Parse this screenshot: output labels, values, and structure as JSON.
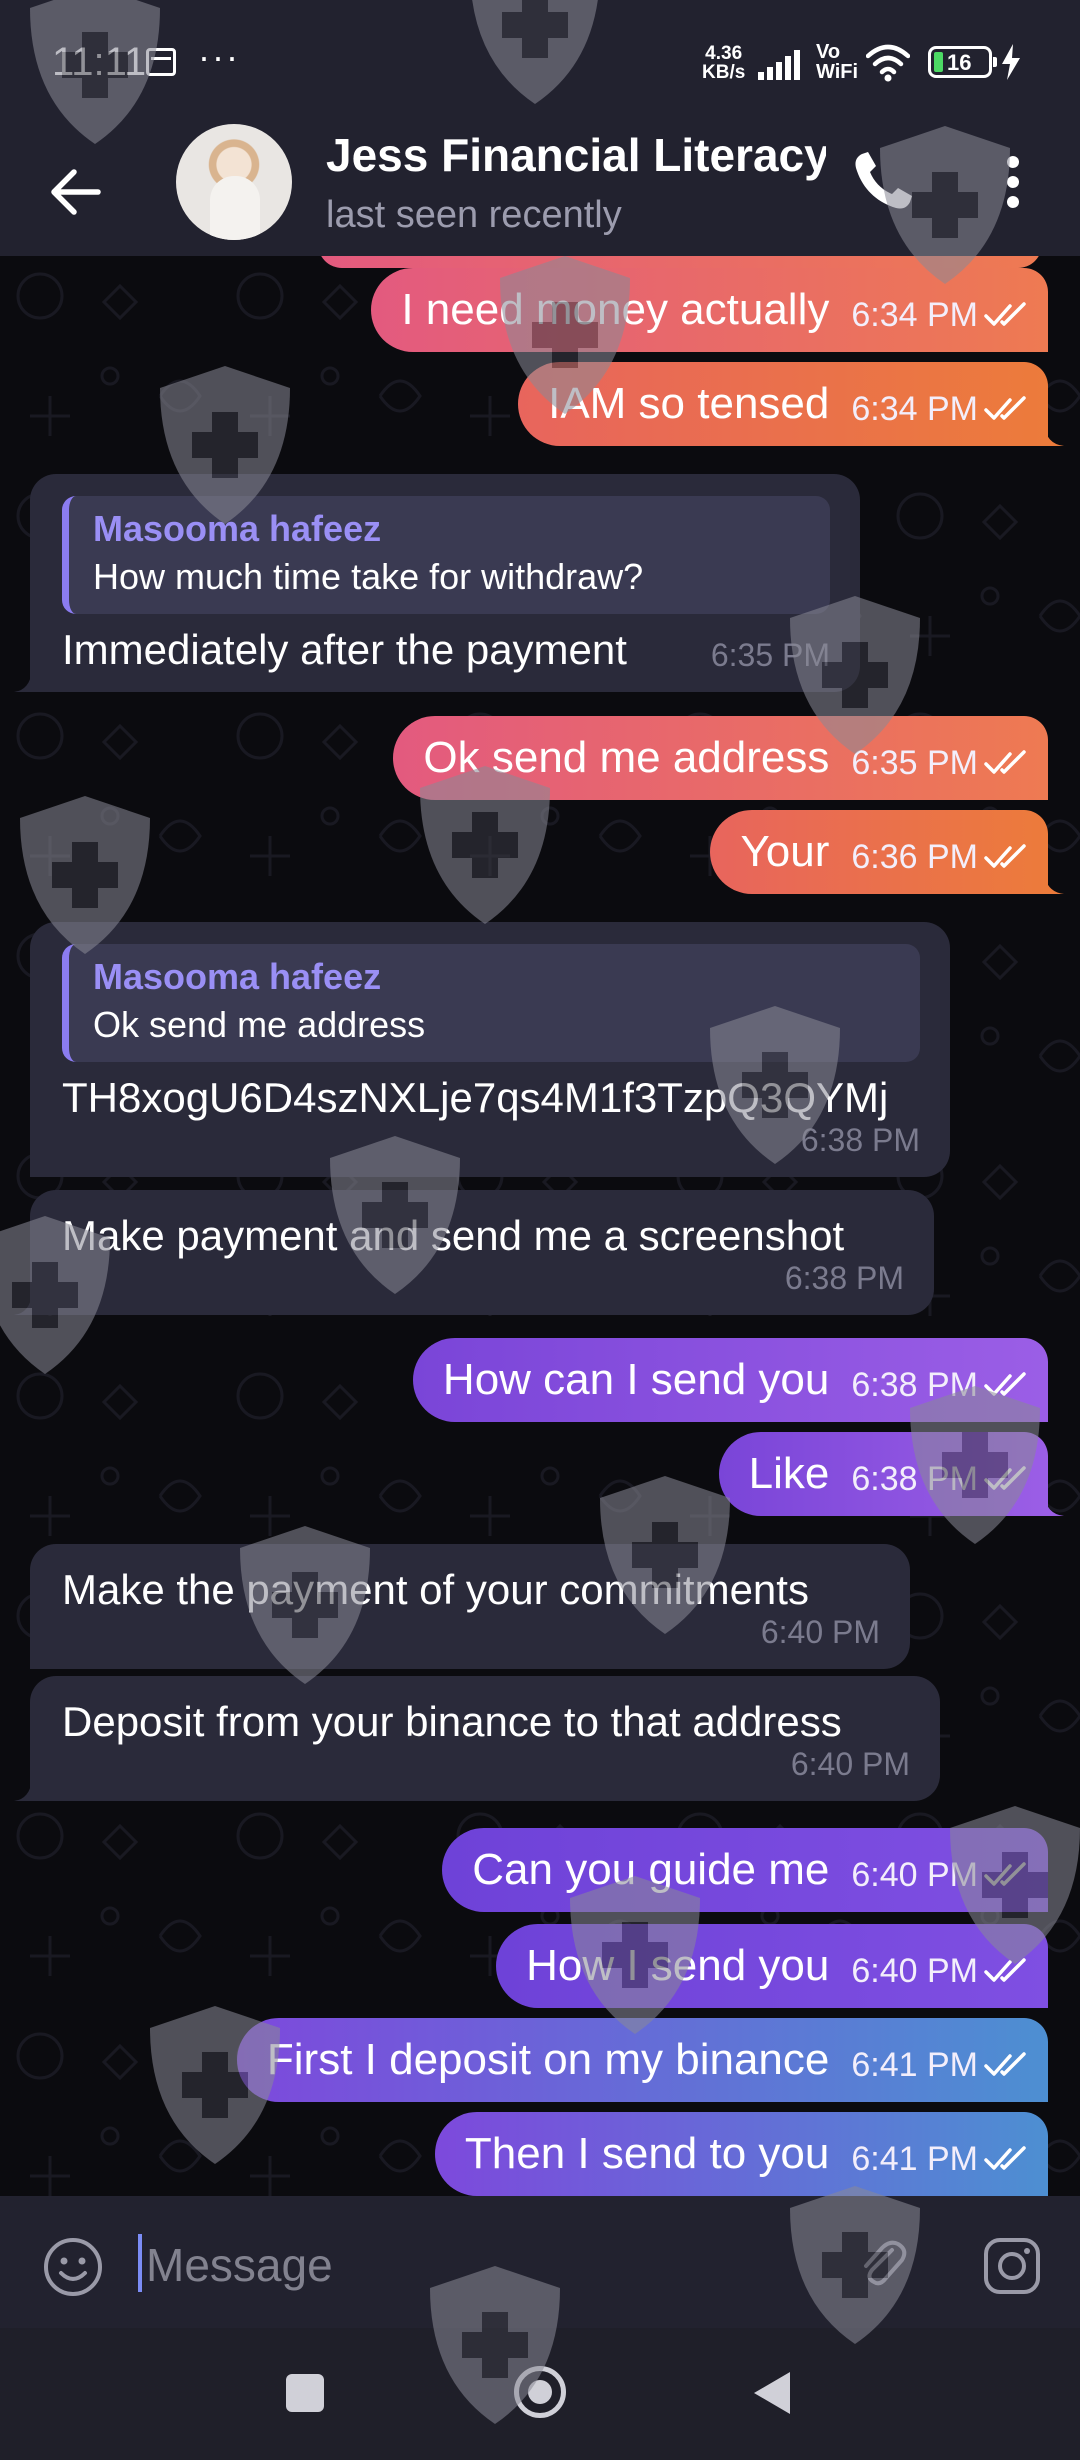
{
  "status_bar": {
    "time": "11:11",
    "more": "···",
    "net_speed_value": "4.36",
    "net_speed_unit": "KB/s",
    "vowifi_top": "Vo",
    "vowifi_bottom": "WiFi",
    "battery": "16"
  },
  "header": {
    "title": "Jess Financial Literacy",
    "subtitle": "last seen recently"
  },
  "messages": [
    {
      "dir": "out",
      "text": "I need money actually",
      "time": "6:34 PM"
    },
    {
      "dir": "out",
      "text": "IAM so tensed",
      "time": "6:34 PM"
    },
    {
      "dir": "in",
      "reply_name": "Masooma hafeez",
      "reply_text": "How much time take for withdraw?",
      "text": "Immediately after the payment",
      "time": "6:35 PM"
    },
    {
      "dir": "out",
      "text": "Ok send me address",
      "time": "6:35 PM"
    },
    {
      "dir": "out",
      "text": "Your",
      "time": "6:36 PM"
    },
    {
      "dir": "in",
      "reply_name": "Masooma hafeez",
      "reply_text": "Ok send me address",
      "text": "TH8xogU6D4szNXLje7qs4M1f3TzpQ3QYMj",
      "time": "6:38 PM"
    },
    {
      "dir": "in",
      "text": "Make payment and send me a screenshot",
      "time": "6:38 PM"
    },
    {
      "dir": "out",
      "text": "How can I send you",
      "time": "6:38 PM"
    },
    {
      "dir": "out",
      "text": "Like",
      "time": "6:38 PM"
    },
    {
      "dir": "in",
      "text": "Make the payment of your commitments",
      "time": "6:40 PM"
    },
    {
      "dir": "in",
      "text": "Deposit from your binance to that address",
      "time": "6:40 PM"
    },
    {
      "dir": "out",
      "text": "Can you guide me",
      "time": "6:40 PM"
    },
    {
      "dir": "out",
      "text": "How I send you",
      "time": "6:40 PM"
    },
    {
      "dir": "out",
      "text": "First I deposit on my binance",
      "time": "6:41 PM"
    },
    {
      "dir": "out",
      "text": "Then I send to you",
      "time": "6:41 PM"
    }
  ],
  "input": {
    "placeholder": "Message"
  },
  "icons": {
    "back": "arrow-left-icon",
    "call": "phone-icon",
    "menu": "more-vertical-icon",
    "emoji": "smiley-icon",
    "attach": "paperclip-icon",
    "camera": "instagram-camera-icon"
  },
  "colors": {
    "header_bg": "#22222f",
    "incoming_bubble": "#2a2a3a",
    "reply_accent": "#9a8ff5",
    "outgoing_pink": "#e35a7f",
    "outgoing_orange": "#ec7b3b",
    "outgoing_purple": "#7a45d8",
    "outgoing_blue": "#4d8fd2"
  }
}
